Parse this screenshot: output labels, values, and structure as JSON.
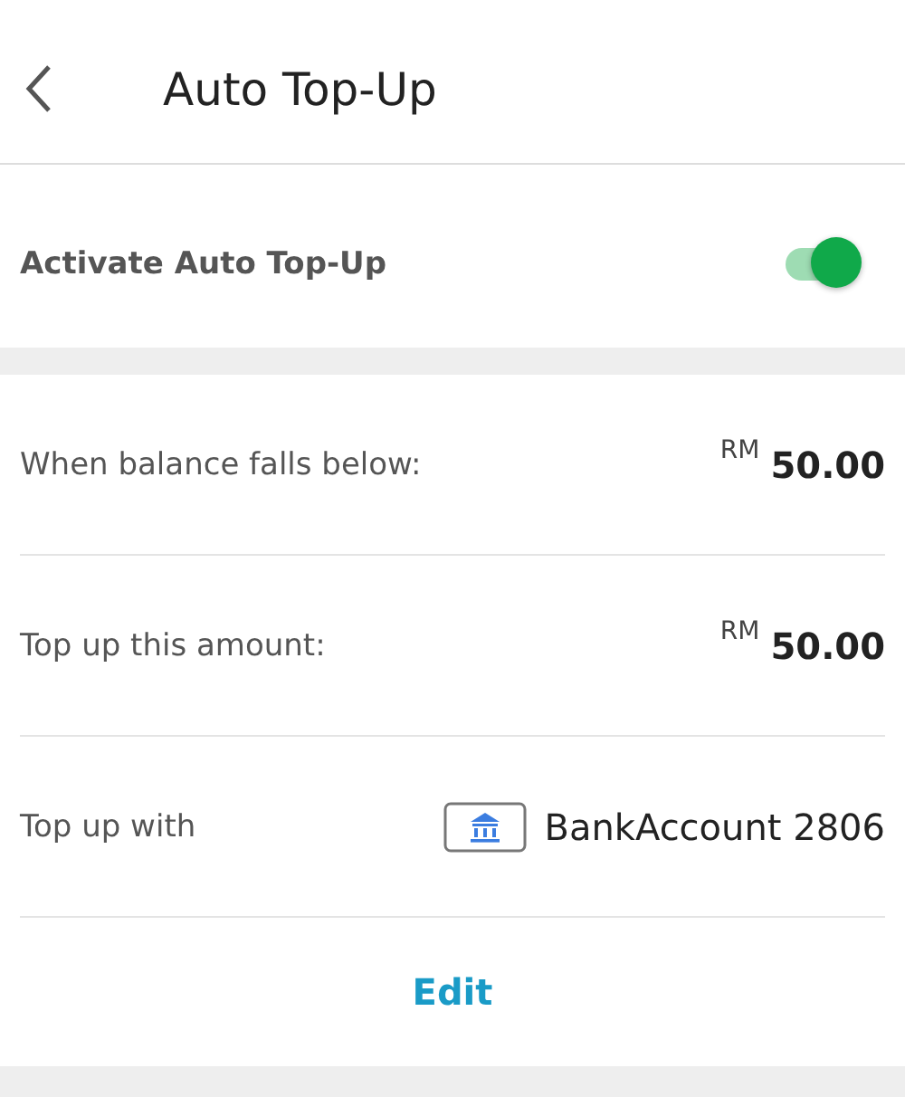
{
  "header": {
    "title": "Auto Top-Up"
  },
  "activate": {
    "label": "Activate Auto Top-Up",
    "on": true
  },
  "rows": [
    {
      "kind": "amount",
      "label": "When balance falls below:",
      "currency": "RM",
      "amount": "50.00"
    },
    {
      "kind": "amount",
      "label": "Top up this amount:",
      "currency": "RM",
      "amount": "50.00"
    },
    {
      "kind": "method",
      "label": "Top up with",
      "value": "BankAccount 2806"
    }
  ],
  "edit_button": "Edit"
}
